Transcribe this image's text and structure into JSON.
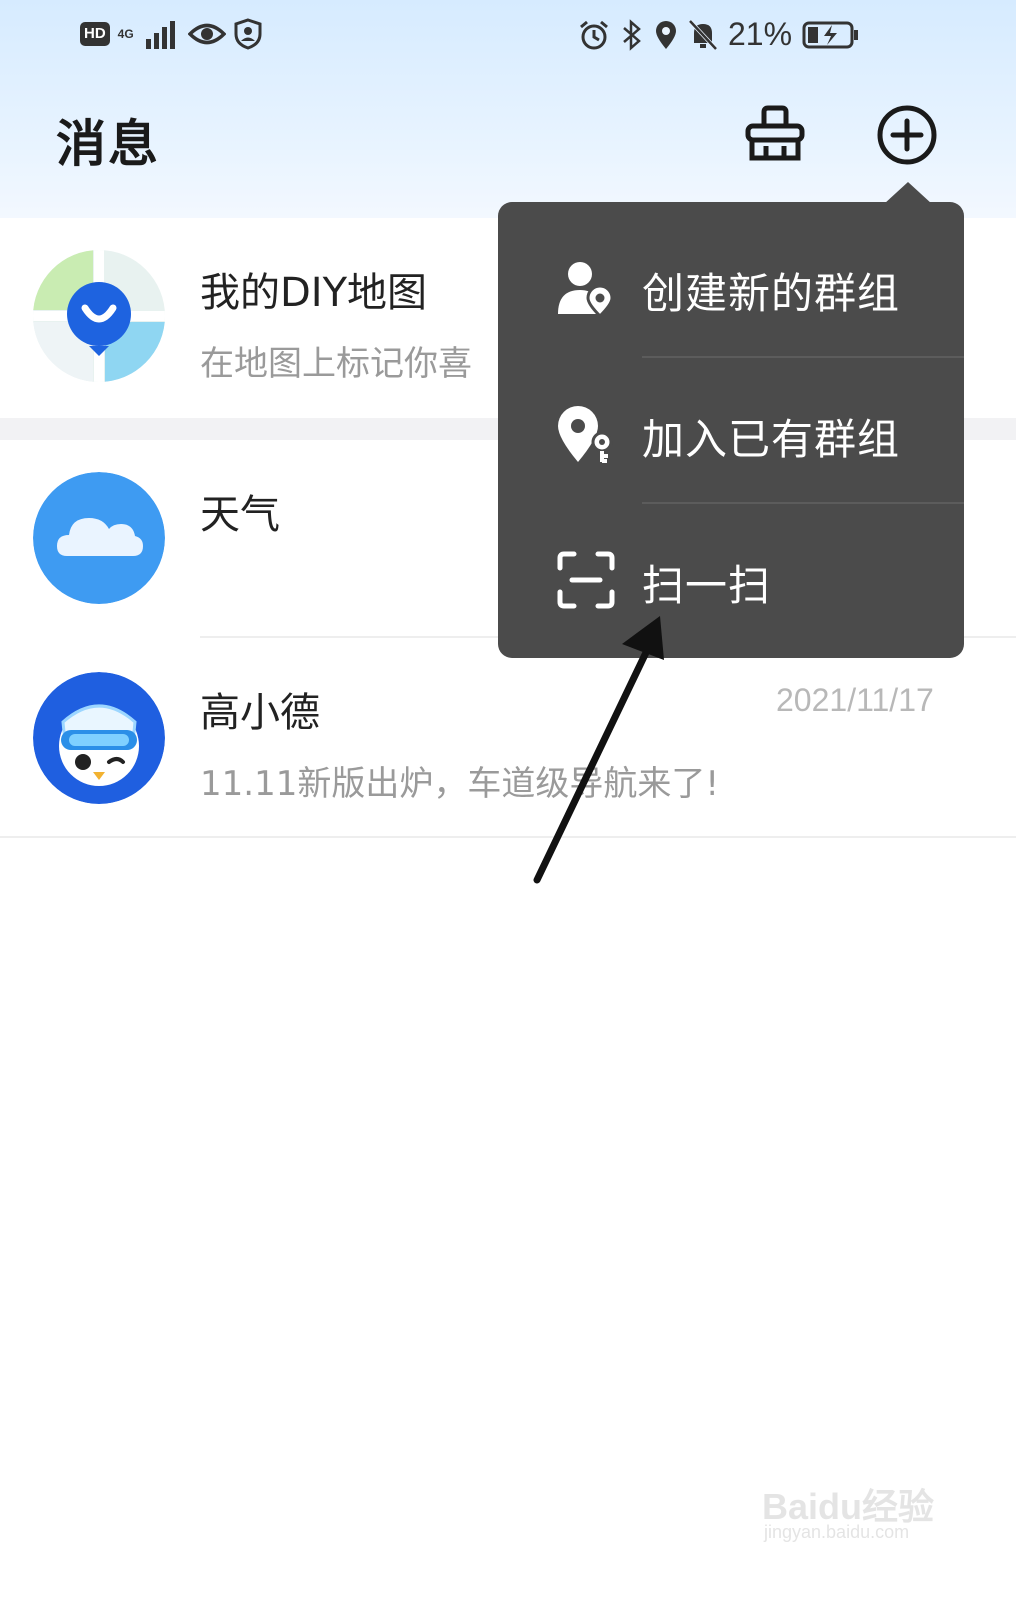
{
  "status_bar": {
    "left_badge": "HD",
    "network": "4G",
    "battery": "21%",
    "icons_left": [
      "hd-icon",
      "signal-icon",
      "eye-icon",
      "shield-icon"
    ],
    "icons_right": [
      "alarm-icon",
      "bluetooth-icon",
      "location-icon",
      "mute-icon",
      "battery-icon"
    ]
  },
  "header": {
    "title": "消息",
    "actions": [
      "clean-icon",
      "add-icon"
    ]
  },
  "messages": [
    {
      "title": "我的DIY地图",
      "subtitle": "在地图上标记你喜",
      "time": "",
      "avatar": "diy-map-avatar"
    },
    {
      "title": "天气",
      "subtitle": "",
      "time": "",
      "avatar": "weather-cloud-avatar"
    },
    {
      "title": "高小德",
      "subtitle": "11.11新版出炉，车道级导航来了!",
      "time": "2021/11/17",
      "avatar": "penguin-avatar"
    }
  ],
  "dropdown": {
    "items": [
      {
        "label": "创建新的群组",
        "icon": "create-group-icon"
      },
      {
        "label": "加入已有群组",
        "icon": "join-group-icon"
      },
      {
        "label": "扫一扫",
        "icon": "scan-icon"
      }
    ]
  },
  "watermark": {
    "brand": "Baidu经验",
    "url": "jingyan.baidu.com"
  },
  "colors": {
    "header_gradient_top": "#d6ebff",
    "menu_bg": "#4b4b4b",
    "avatar_blue": "#1e63e0",
    "weather_blue": "#3e9bf2"
  }
}
